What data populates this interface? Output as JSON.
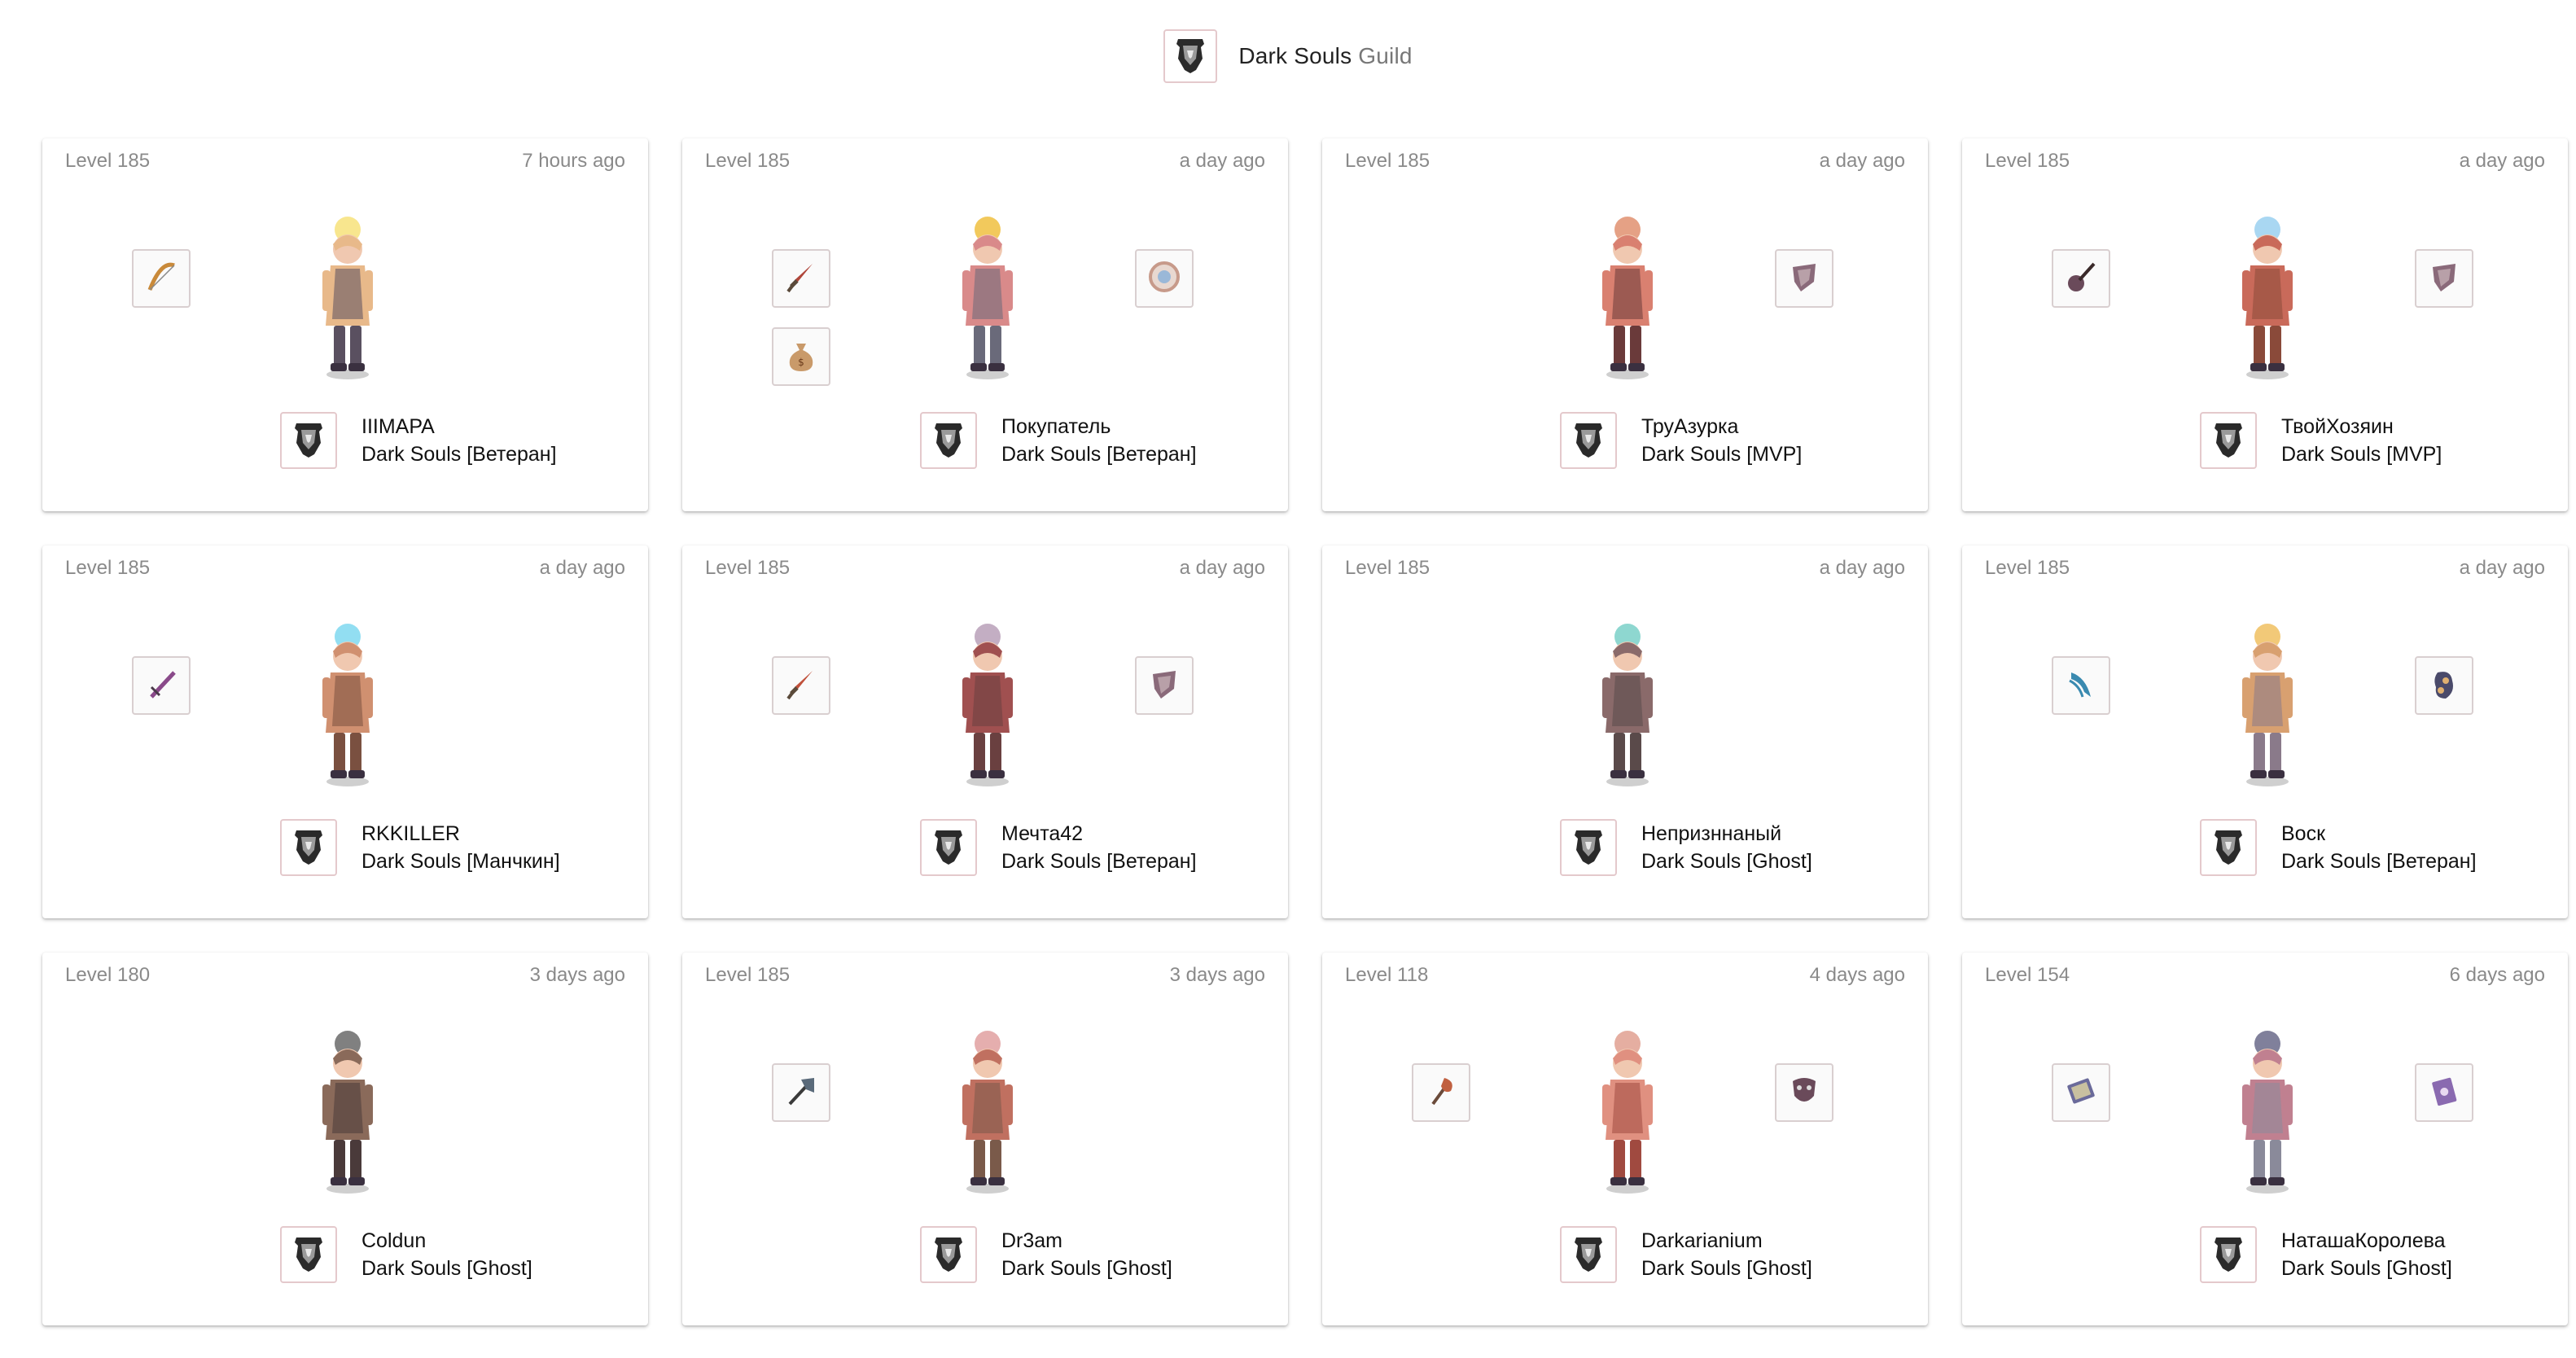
{
  "header": {
    "name": "Dark Souls",
    "suffix": "Guild",
    "emblem_icon": "guild-emblem-icon"
  },
  "colors": {
    "card_bg": "#ffffff",
    "muted_text": "#8a8a8a",
    "emblem_border": "#e4c9cc",
    "item_border": "#d9cfd0"
  },
  "members": [
    {
      "level": "Level 185",
      "ago": "7 hours ago",
      "name": "IIIMAPA",
      "guild_rank": "Dark Souls [Ветеран]",
      "items": [
        {
          "slot": "l1",
          "icon": "bow-icon",
          "color": "#c98a3a"
        }
      ],
      "sprite_colors": [
        "#e8b98a",
        "#5a5060",
        "#f7e27a"
      ]
    },
    {
      "level": "Level 185",
      "ago": "a day ago",
      "name": "Покупатель",
      "guild_rank": "Dark Souls [Ветеран]",
      "items": [
        {
          "slot": "l1",
          "icon": "dagger-icon",
          "color": "#b0463a"
        },
        {
          "slot": "l2",
          "icon": "money-bag-icon",
          "color": "#c99a6a"
        },
        {
          "slot": "r1",
          "icon": "shield-orb-icon",
          "color": "#c79a8a"
        }
      ],
      "sprite_colors": [
        "#d98a8a",
        "#6a6a7a",
        "#f0c040"
      ]
    },
    {
      "level": "Level 185",
      "ago": "a day ago",
      "name": "ТруАзурка",
      "guild_rank": "Dark Souls [MVP]",
      "items": [
        {
          "slot": "r1",
          "icon": "shield-icon",
          "color": "#8a6a7a"
        }
      ],
      "sprite_colors": [
        "#d98070",
        "#6a3a3a",
        "#e09070"
      ]
    },
    {
      "level": "Level 185",
      "ago": "a day ago",
      "name": "ТвойХозяин",
      "guild_rank": "Dark Souls [MVP]",
      "items": [
        {
          "slot": "l1",
          "icon": "guitar-icon",
          "color": "#6a4a5a"
        },
        {
          "slot": "r1",
          "icon": "shield-icon",
          "color": "#8a6a7a"
        }
      ],
      "sprite_colors": [
        "#c96a5a",
        "#8a4a3a",
        "#9ad0f0"
      ]
    },
    {
      "level": "Level 185",
      "ago": "a day ago",
      "name": "RKKILLER",
      "guild_rank": "Dark Souls [Манчкин]",
      "items": [
        {
          "slot": "l1",
          "icon": "sword-icon",
          "color": "#8a4a8a"
        }
      ],
      "sprite_colors": [
        "#d09070",
        "#7a5040",
        "#7fd8f0"
      ]
    },
    {
      "level": "Level 185",
      "ago": "a day ago",
      "name": "Мечта42",
      "guild_rank": "Dark Souls [Ветеран]",
      "items": [
        {
          "slot": "l1",
          "icon": "dagger-icon",
          "color": "#c0503a"
        },
        {
          "slot": "r1",
          "icon": "shield-icon",
          "color": "#8a6a7a"
        }
      ],
      "sprite_colors": [
        "#a05050",
        "#6a4040",
        "#b8a0b8"
      ]
    },
    {
      "level": "Level 185",
      "ago": "a day ago",
      "name": "Непризннаный",
      "guild_rank": "Dark Souls [Ghost]",
      "items": [],
      "sprite_colors": [
        "#8a6a6a",
        "#5a4a4a",
        "#7ad0c8"
      ]
    },
    {
      "level": "Level 185",
      "ago": "a day ago",
      "name": "Bocк",
      "guild_rank": "Dark Souls [Ветеран]",
      "items": [
        {
          "slot": "l1",
          "icon": "claw-icon",
          "color": "#3a8ab0"
        },
        {
          "slot": "r1",
          "icon": "gem-icon",
          "color": "#4a4a6a"
        }
      ],
      "sprite_colors": [
        "#d8a070",
        "#8a7a8a",
        "#f0c060"
      ]
    },
    {
      "level": "Level 180",
      "ago": "3 days ago",
      "name": "Coldun",
      "guild_rank": "Dark Souls [Ghost]",
      "items": [],
      "sprite_colors": [
        "#8a6a5a",
        "#4a3a3a",
        "#6a6a6a"
      ]
    },
    {
      "level": "Level 185",
      "ago": "3 days ago",
      "name": "Dr3am",
      "guild_rank": "Dark Souls [Ghost]",
      "items": [
        {
          "slot": "l1",
          "icon": "axe-icon",
          "color": "#5a6a7a"
        }
      ],
      "sprite_colors": [
        "#c07060",
        "#7a5a4a",
        "#e0a0a0"
      ]
    },
    {
      "level": "Level 118",
      "ago": "4 days ago",
      "name": "Darkarianium",
      "guild_rank": "Dark Souls [Ghost]",
      "items": [
        {
          "slot": "l1",
          "icon": "torch-icon",
          "color": "#c06040"
        },
        {
          "slot": "r1",
          "icon": "mask-icon",
          "color": "#6a4a5a"
        }
      ],
      "sprite_colors": [
        "#e09080",
        "#a04a40",
        "#e0a090"
      ]
    },
    {
      "level": "Level 154",
      "ago": "6 days ago",
      "name": "НаташаКоролева",
      "guild_rank": "Dark Souls [Ghost]",
      "items": [
        {
          "slot": "l1",
          "icon": "book-icon",
          "color": "#6a6a9a"
        },
        {
          "slot": "r1",
          "icon": "spellbook-icon",
          "color": "#8a6ab0"
        }
      ],
      "sprite_colors": [
        "#c08090",
        "#8a8a9a",
        "#6a6a8a"
      ]
    }
  ]
}
